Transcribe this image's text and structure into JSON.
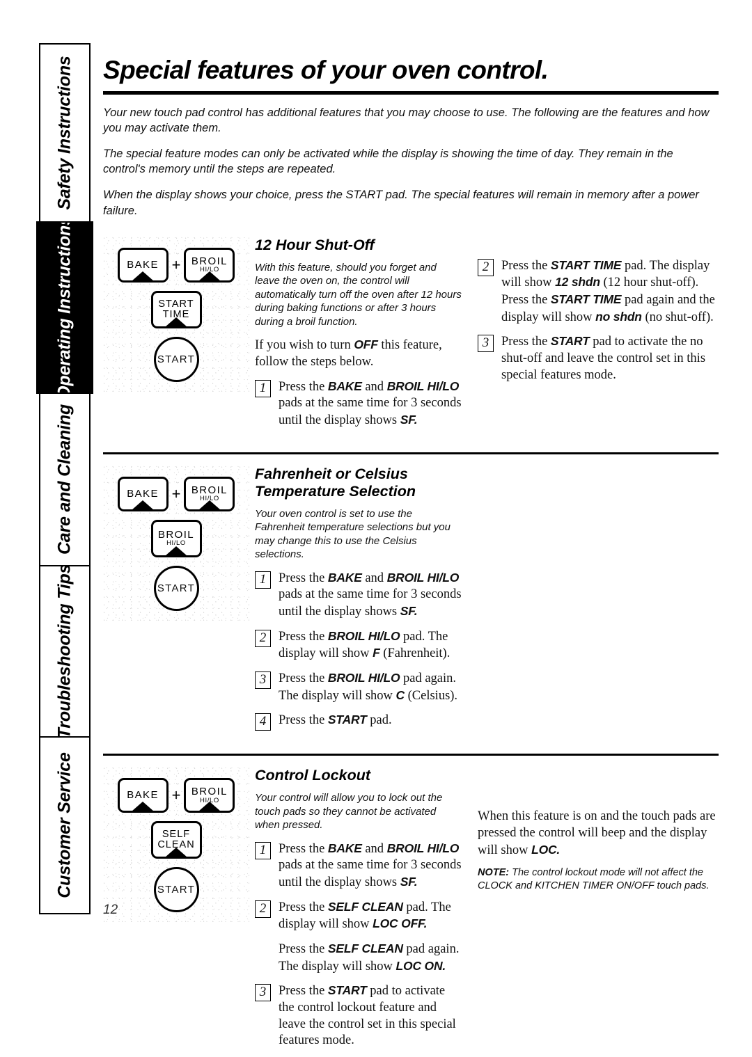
{
  "sidebar": {
    "tabs": [
      {
        "label": "Safety Instructions",
        "active": false
      },
      {
        "label": "Operating Instructions",
        "active": true
      },
      {
        "label": "Care and Cleaning",
        "active": false
      },
      {
        "label": "Troubleshooting Tips",
        "active": false
      },
      {
        "label": "Customer Service",
        "active": false
      }
    ]
  },
  "page": {
    "title": "Special features of your oven control.",
    "number": "12",
    "intro": [
      "Your new touch pad control has additional features that you may choose to use. The following are the features and how you may activate them.",
      "The special feature modes can only be activated while the display is showing the time of day. They remain in the control's memory until the steps are repeated.",
      "When the display shows your choice, press the START pad. The special features will remain in memory after a power failure."
    ]
  },
  "sections": [
    {
      "heading": "12 Hour Shut-Off",
      "intro": "With this feature, should you forget and leave the oven on, the control will automatically turn off the oven after 12 hours during baking functions or after 3 hours during a broil function.",
      "lead": "If you wish to turn OFF this feature, follow the steps below.",
      "lead_bold": "OFF",
      "steps_left": [
        {
          "num": "1",
          "parts": [
            {
              "t": "Press the ",
              "b": false
            },
            {
              "t": "BAKE",
              "b": true
            },
            {
              "t": " and ",
              "b": false
            },
            {
              "t": "BROIL HI/LO",
              "b": true
            },
            {
              "t": " pads at the same time for 3 seconds until the display shows ",
              "b": false
            },
            {
              "t": "SF.",
              "b": true
            }
          ]
        }
      ],
      "steps_right": [
        {
          "num": "2",
          "parts": [
            {
              "t": "Press the ",
              "b": false
            },
            {
              "t": "START TIME",
              "b": true
            },
            {
              "t": " pad. The display will show ",
              "b": false
            },
            {
              "t": "12 shdn",
              "b": true
            },
            {
              "t": " (12 hour shut-off). Press the ",
              "b": false
            },
            {
              "t": "START TIME",
              "b": true
            },
            {
              "t": " pad again and the display will show ",
              "b": false
            },
            {
              "t": "no shdn",
              "b": true
            },
            {
              "t": " (no shut-off).",
              "b": false
            }
          ]
        },
        {
          "num": "3",
          "parts": [
            {
              "t": "Press the ",
              "b": false
            },
            {
              "t": "START",
              "b": true
            },
            {
              "t": " pad to activate the no shut-off and leave the control set in this special features mode.",
              "b": false
            }
          ]
        }
      ],
      "diagram": {
        "top": [
          {
            "main": "BAKE",
            "sub": ""
          },
          {
            "main": "BROIL",
            "sub": "HI/LO"
          }
        ],
        "middle": {
          "main": "START TIME",
          "sub": ""
        },
        "start": "START"
      }
    },
    {
      "heading": "Fahrenheit or Celsius Temperature Selection",
      "intro": "Your oven control is set to use the Fahrenheit temperature selections but you may change this to use the Celsius selections.",
      "lead": "",
      "lead_bold": "",
      "steps_left": [
        {
          "num": "1",
          "parts": [
            {
              "t": "Press the ",
              "b": false
            },
            {
              "t": "BAKE",
              "b": true
            },
            {
              "t": " and ",
              "b": false
            },
            {
              "t": "BROIL HI/LO",
              "b": true
            },
            {
              "t": " pads at the same time for 3 seconds until the display shows ",
              "b": false
            },
            {
              "t": "SF.",
              "b": true
            }
          ]
        },
        {
          "num": "2",
          "parts": [
            {
              "t": "Press the ",
              "b": false
            },
            {
              "t": "BROIL HI/LO",
              "b": true
            },
            {
              "t": " pad. The display will show ",
              "b": false
            },
            {
              "t": "F",
              "b": true
            },
            {
              "t": " (Fahrenheit).",
              "b": false
            }
          ]
        },
        {
          "num": "3",
          "parts": [
            {
              "t": "Press the ",
              "b": false
            },
            {
              "t": "BROIL HI/LO",
              "b": true
            },
            {
              "t": " pad again. The display will show ",
              "b": false
            },
            {
              "t": "C",
              "b": true
            },
            {
              "t": " (Celsius).",
              "b": false
            }
          ]
        },
        {
          "num": "4",
          "parts": [
            {
              "t": "Press the ",
              "b": false
            },
            {
              "t": "START",
              "b": true
            },
            {
              "t": " pad.",
              "b": false
            }
          ]
        }
      ],
      "steps_right": [],
      "diagram": {
        "top": [
          {
            "main": "BAKE",
            "sub": ""
          },
          {
            "main": "BROIL",
            "sub": "HI/LO"
          }
        ],
        "middle": {
          "main": "BROIL",
          "sub": "HI/LO"
        },
        "start": "START"
      }
    },
    {
      "heading": "Control Lockout",
      "intro": "Your control will allow you to lock out the touch pads so they cannot be activated when pressed.",
      "lead": "",
      "lead_bold": "",
      "steps_left": [
        {
          "num": "1",
          "parts": [
            {
              "t": "Press the ",
              "b": false
            },
            {
              "t": "BAKE",
              "b": true
            },
            {
              "t": " and ",
              "b": false
            },
            {
              "t": "BROIL HI/LO",
              "b": true
            },
            {
              "t": " pads at the same time for 3 seconds until the display shows ",
              "b": false
            },
            {
              "t": "SF.",
              "b": true
            }
          ]
        },
        {
          "num": "2",
          "parts": [
            {
              "t": "Press the ",
              "b": false
            },
            {
              "t": "SELF CLEAN",
              "b": true
            },
            {
              "t": " pad. The display will show ",
              "b": false
            },
            {
              "t": "LOC OFF.",
              "b": true
            }
          ]
        },
        {
          "num": "",
          "parts": [
            {
              "t": "Press the ",
              "b": false
            },
            {
              "t": "SELF CLEAN",
              "b": true
            },
            {
              "t": " pad again. The display will show ",
              "b": false
            },
            {
              "t": "LOC ON.",
              "b": true
            }
          ]
        },
        {
          "num": "3",
          "parts": [
            {
              "t": "Press the ",
              "b": false
            },
            {
              "t": "START",
              "b": true
            },
            {
              "t": " pad to activate the control lockout feature and leave the control set in this special features mode.",
              "b": false
            }
          ]
        }
      ],
      "steps_right": [],
      "right_paragraph": [
        {
          "t": "When this feature is on and the touch pads are pressed the control will beep and the display will show ",
          "b": false
        },
        {
          "t": "LOC.",
          "b": true
        }
      ],
      "note": {
        "label": "NOTE:",
        "text": " The control lockout mode will not affect the CLOCK and KITCHEN TIMER ON/OFF touch pads."
      },
      "diagram": {
        "top": [
          {
            "main": "BAKE",
            "sub": ""
          },
          {
            "main": "BROIL",
            "sub": "HI/LO"
          }
        ],
        "middle": {
          "main": "SELF CLEAN",
          "sub": ""
        },
        "start": "START"
      }
    }
  ]
}
